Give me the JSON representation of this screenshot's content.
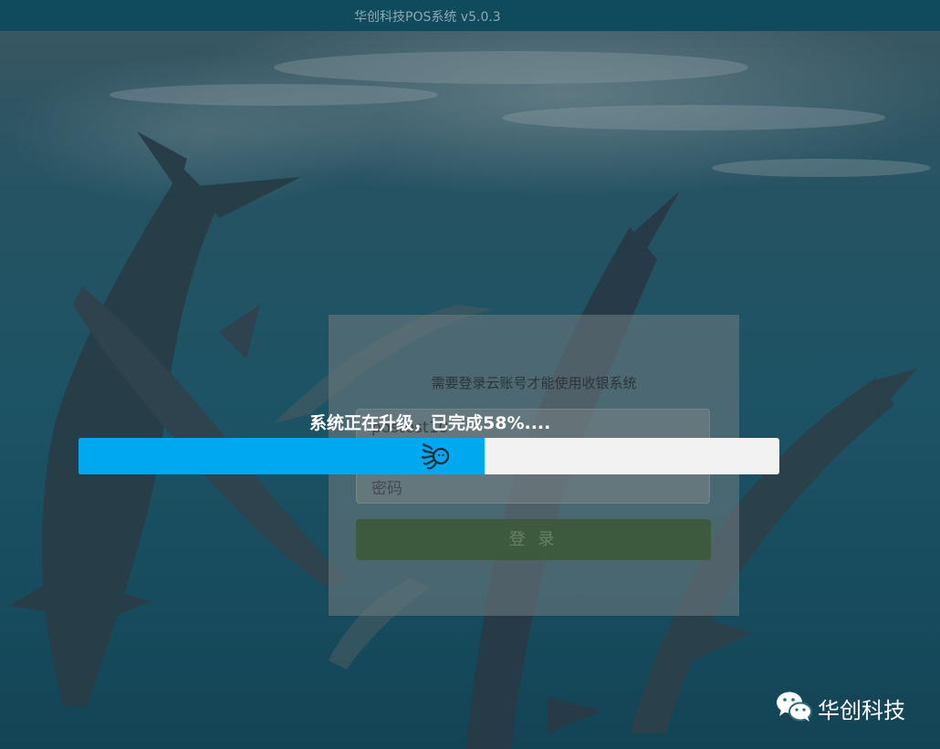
{
  "window": {
    "title": "华创科技POS系统 v5.0.3"
  },
  "login": {
    "subtitle": "需要登录云账号才能使用收银系统",
    "username_value": "postest10",
    "password_placeholder": "密码",
    "login_label": "登 录"
  },
  "upgrade": {
    "status_text": "系统正在升级，已完成58%....",
    "progress": 0.58,
    "colors": {
      "fill": "#00a8f0",
      "track": "#f2f2f2"
    }
  },
  "watermark": {
    "text": "华创科技",
    "icon": "wechat-icon"
  }
}
